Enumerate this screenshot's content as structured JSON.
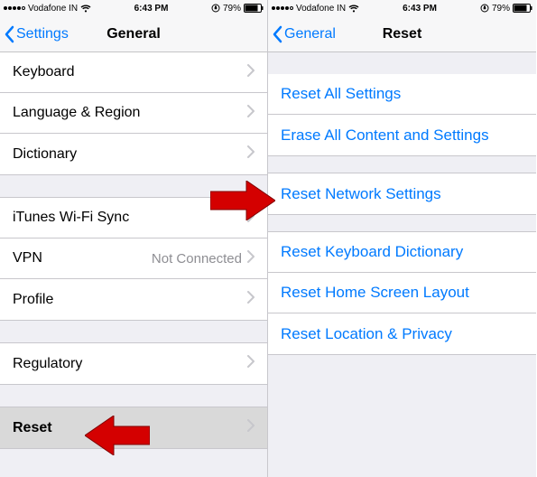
{
  "status": {
    "carrier": "Vodafone IN",
    "time": "6:43 PM",
    "battery": "79%"
  },
  "left": {
    "back": "Settings",
    "title": "General",
    "rows": {
      "keyboard": "Keyboard",
      "language": "Language & Region",
      "dictionary": "Dictionary",
      "itunes": "iTunes Wi-Fi Sync",
      "vpn": "VPN",
      "vpn_detail": "Not Connected",
      "profile": "Profile",
      "regulatory": "Regulatory",
      "reset": "Reset"
    }
  },
  "right": {
    "back": "General",
    "title": "Reset",
    "rows": {
      "reset_all": "Reset All Settings",
      "erase_all": "Erase All Content and Settings",
      "reset_network": "Reset Network Settings",
      "reset_keyboard": "Reset Keyboard Dictionary",
      "reset_home": "Reset Home Screen Layout",
      "reset_location": "Reset Location & Privacy"
    }
  }
}
